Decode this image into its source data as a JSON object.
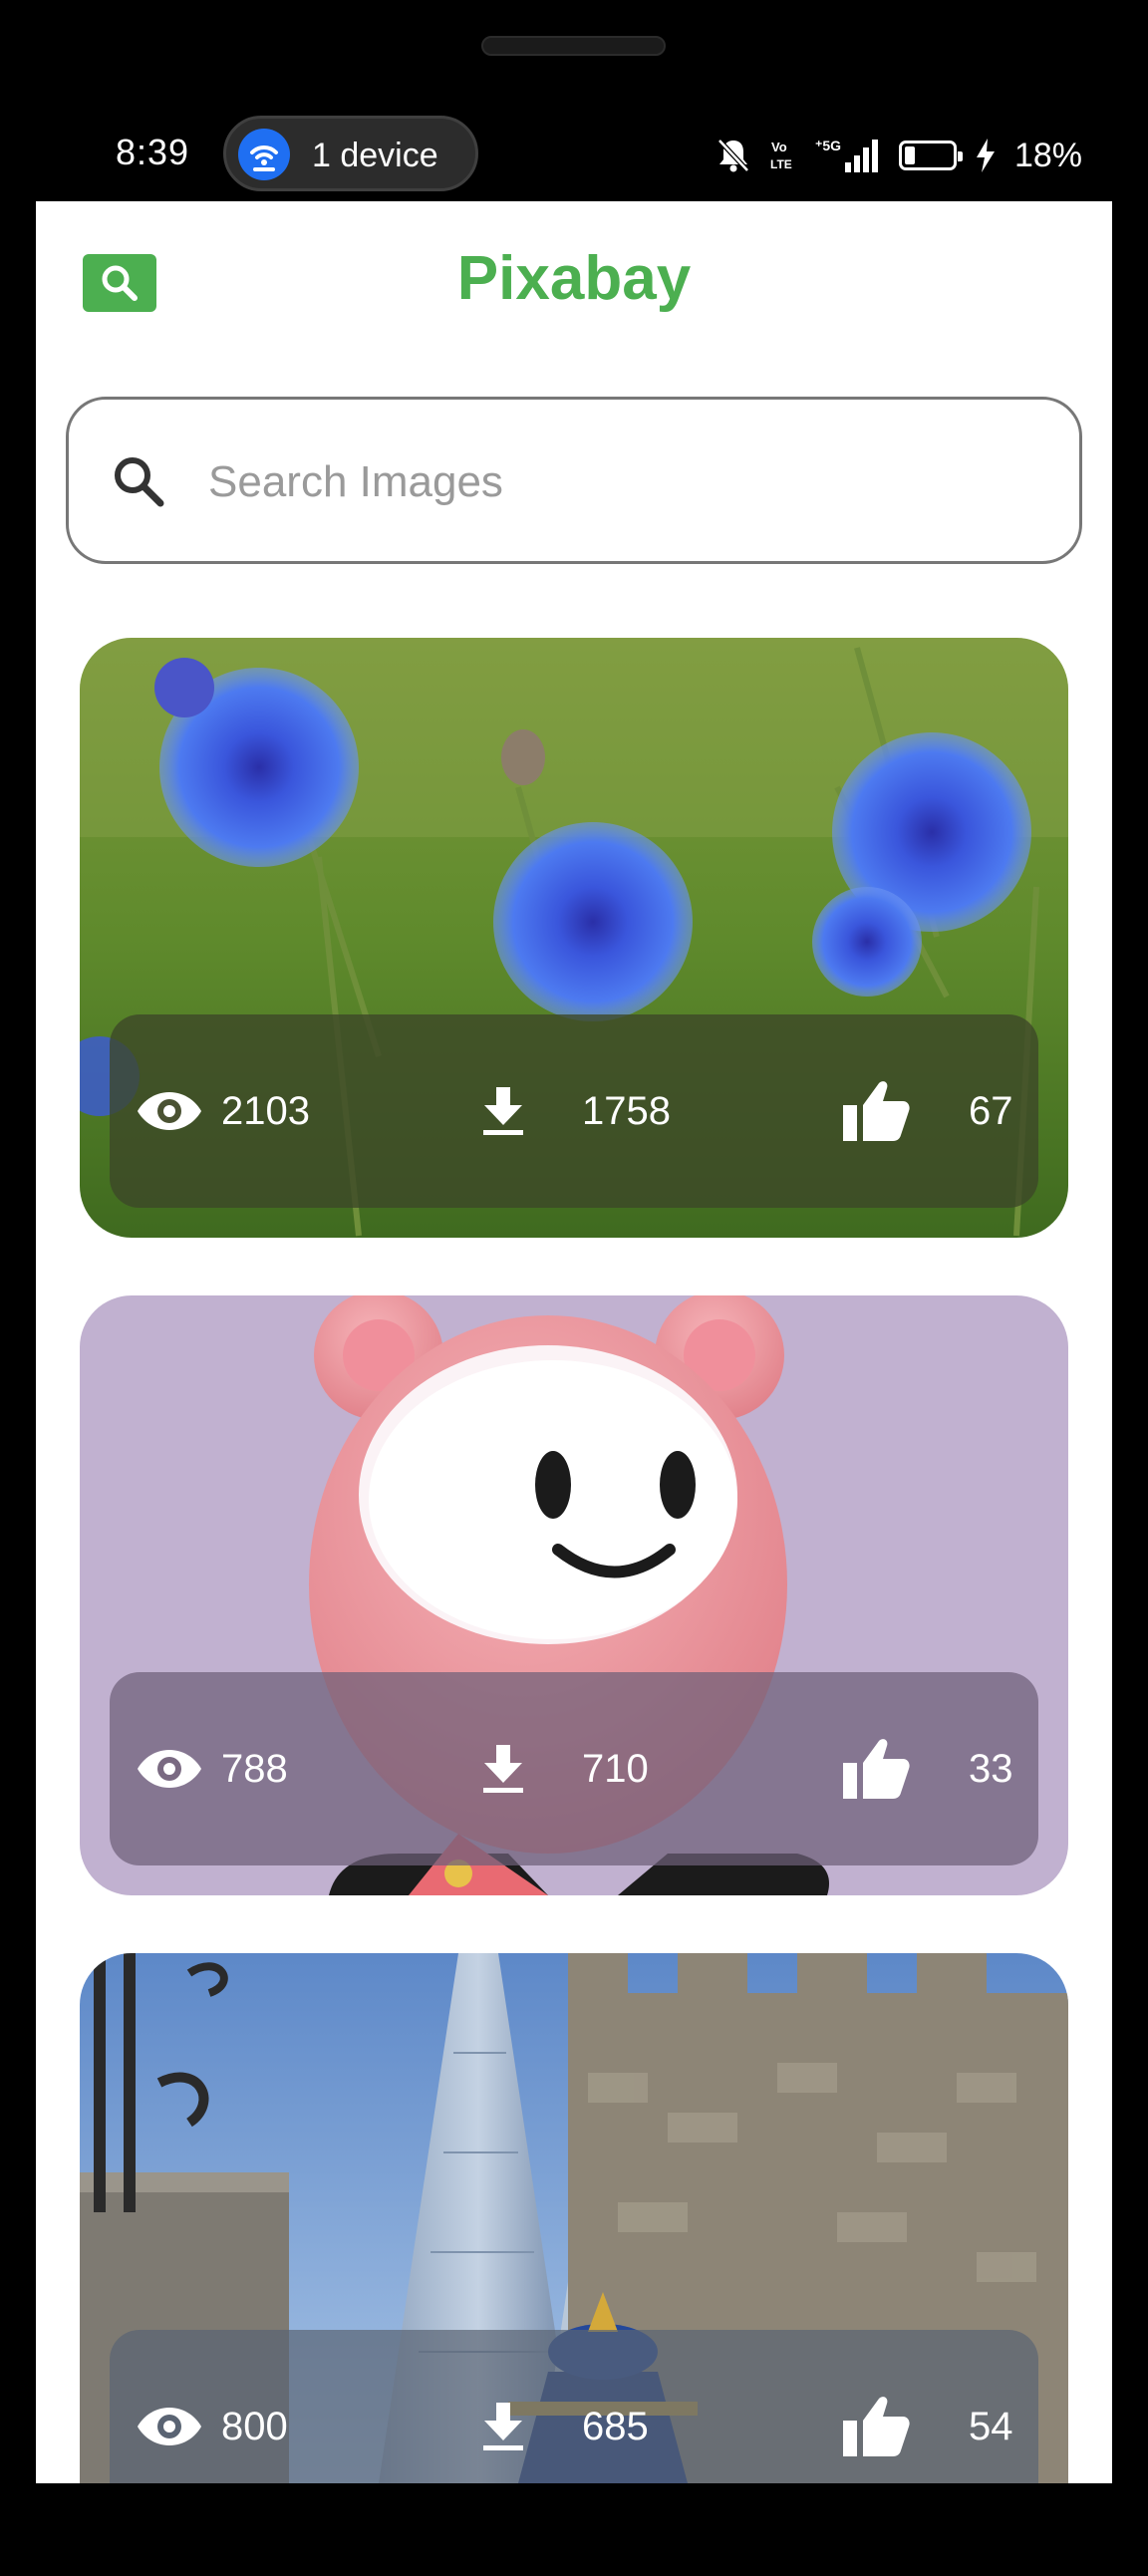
{
  "status_bar": {
    "time": "8:39",
    "connected_devices": "1 device",
    "battery_percent": "18%",
    "network_label": "5G",
    "volte_label": "Vo LTE"
  },
  "app": {
    "title": "Pixabay",
    "accent_color": "#4caf50"
  },
  "search": {
    "placeholder": "Search Images",
    "value": ""
  },
  "images": [
    {
      "subject": "blue cornflowers",
      "views": "2103",
      "downloads": "1758",
      "likes": "67"
    },
    {
      "subject": "pink bear toy",
      "views": "788",
      "downloads": "710",
      "likes": "33"
    },
    {
      "subject": "castle tower and skyscraper",
      "views": "800",
      "downloads": "685",
      "likes": "54"
    }
  ],
  "icons": {
    "views": "eye-icon",
    "downloads": "download-icon",
    "likes": "thumbs-up-icon",
    "search": "search-icon"
  }
}
